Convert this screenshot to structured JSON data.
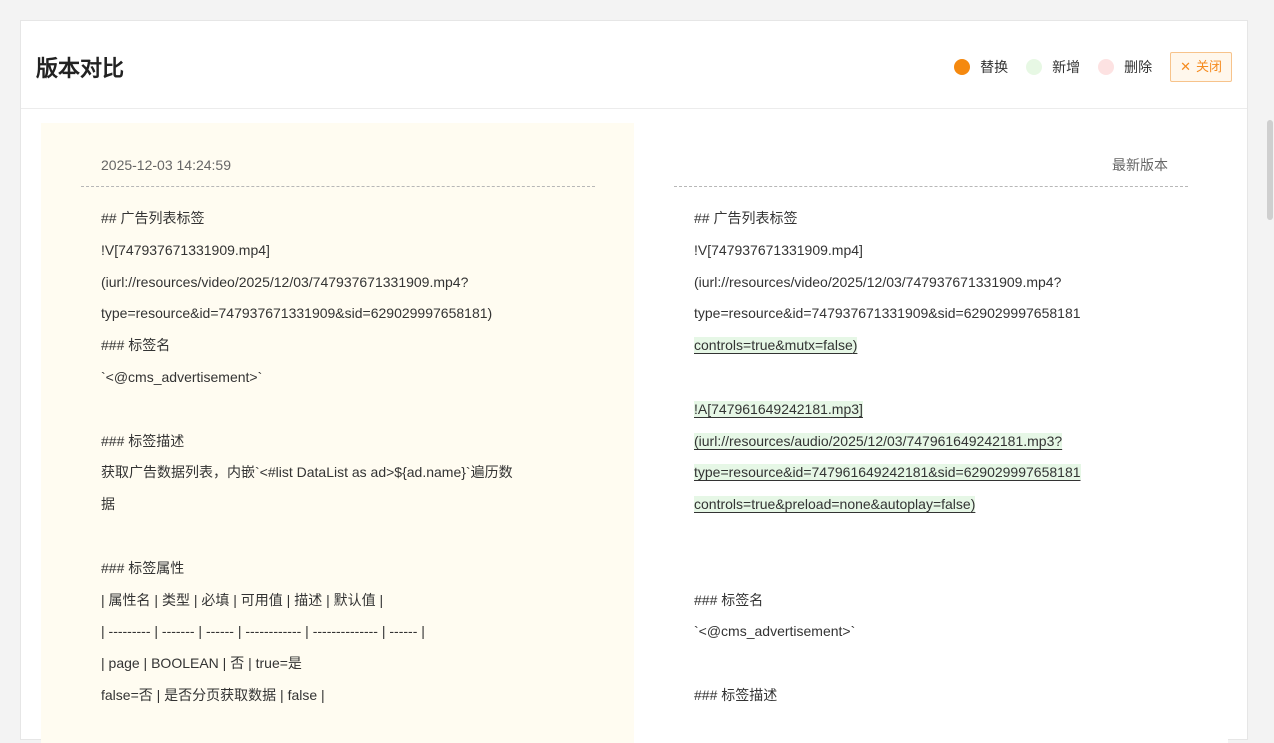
{
  "dialog": {
    "title": "版本对比",
    "legend": [
      {
        "label": "替换",
        "color": "#f5890f"
      },
      {
        "label": "新增",
        "color": "#e7f8e4"
      },
      {
        "label": "删除",
        "color": "#fde2e2"
      }
    ],
    "close_label": "关闭"
  },
  "left": {
    "header": "2025-12-03 14:24:59",
    "lines": [
      "## 广告列表标签",
      "!V[747937671331909.mp4]",
      "(iurl://resources/video/2025/12/03/747937671331909.mp4?",
      "type=resource&id=747937671331909&sid=629029997658181)",
      "### 标签名",
      "`<@cms_advertisement>`",
      "",
      "### 标签描述",
      "获取广告数据列表，内嵌`<#list DataList as ad>${ad.name}`遍历数",
      "据",
      "",
      "### 标签属性",
      "| 属性名 | 类型 | 必填 | 可用值 | 描述 | 默认值 |",
      "| --------- | ------- | ------ | ------------ | -------------- | ------ |",
      "| page | BOOLEAN | 否 | true=是",
      "false=否 | 是否分页获取数据 | false |"
    ]
  },
  "right": {
    "header": "最新版本",
    "lines": [
      {
        "text": "## 广告列表标签"
      },
      {
        "text": "!V[747937671331909.mp4]"
      },
      {
        "text": "(iurl://resources/video/2025/12/03/747937671331909.mp4?"
      },
      {
        "text": "type=resource&id=747937671331909&sid=629029997658181"
      },
      {
        "text": "controls=true&mutx=false",
        "added": true,
        "suffix": ")"
      },
      {
        "text": ""
      },
      {
        "text": "!A[747961649242181.mp3]",
        "added": true
      },
      {
        "text": "(iurl://resources/audio/2025/12/03/747961649242181.mp3?",
        "added": true
      },
      {
        "text": "type=resource&id=747961649242181&sid=629029997658181",
        "added": true
      },
      {
        "text": "controls=true&preload=none&autoplay=false",
        "added": true,
        "suffix": ")"
      },
      {
        "text": ""
      },
      {
        "text": ""
      },
      {
        "text": "### 标签名"
      },
      {
        "text": "`<@cms_advertisement>`"
      },
      {
        "text": ""
      },
      {
        "text": "### 标签描述"
      }
    ]
  }
}
